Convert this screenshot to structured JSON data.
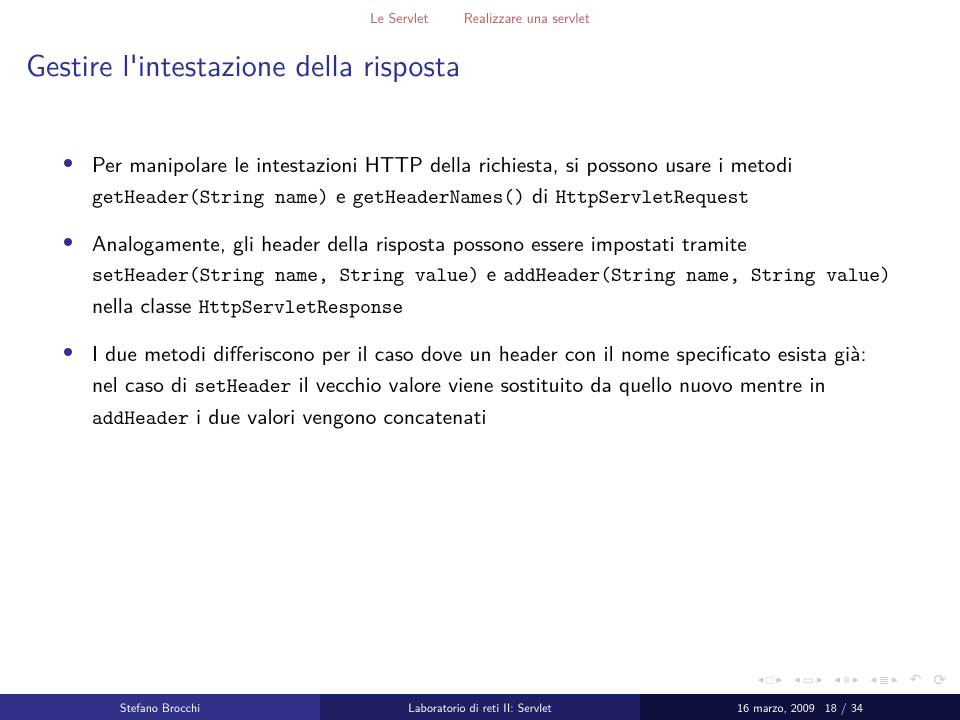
{
  "header": {
    "crumb_section": "Le Servlet",
    "crumb_subsection": "Realizzare una servlet"
  },
  "title": "Gestire l'intestazione della risposta",
  "bullets": {
    "b1": {
      "p1": "Per manipolare le intestazioni HTTP della richiesta, si possono usare i metodi ",
      "c1": "getHeader(String name)",
      "p2": " e ",
      "c2": "getHeaderNames()",
      "p3": " di ",
      "c3": "HttpServletRequest"
    },
    "b2": {
      "p1": "Analogamente, gli header della risposta possono essere impostati tramite ",
      "c1": "setHeader(String name, String value)",
      "p2": " e ",
      "c2": "addHeader(String name, String value)",
      "p3": " nella classe ",
      "c3": "HttpServletResponse"
    },
    "b3": {
      "p1": "I due metodi differiscono per il caso dove un header con il nome specificato esista già: nel caso di ",
      "c1": "setHeader",
      "p2": " il vecchio valore viene sostituito da quello nuovo mentre in ",
      "c2": "addHeader",
      "p3": " i due valori vengono concatenati"
    }
  },
  "footer": {
    "author": "Stefano Brocchi",
    "title": "Laboratorio di reti II: Servlet",
    "date": "16 marzo, 2009",
    "page_current": "18",
    "page_sep": " / ",
    "page_total": "34"
  }
}
